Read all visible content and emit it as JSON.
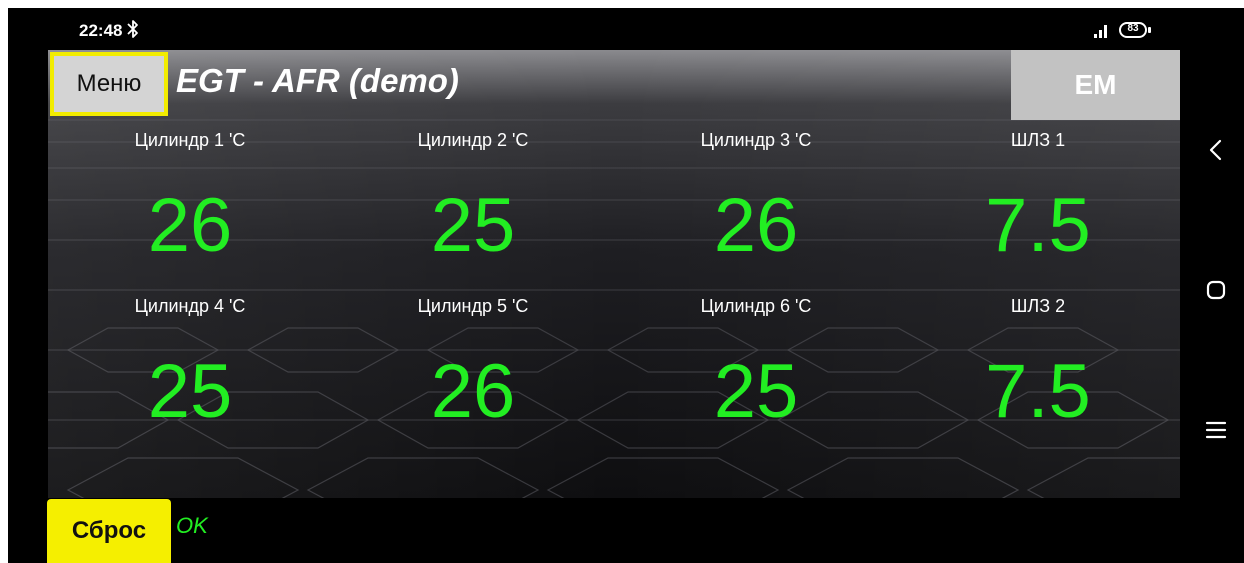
{
  "status_bar": {
    "time": "22:48",
    "battery": "83",
    "icons": [
      "bluetooth-icon",
      "signal-icon",
      "battery-icon"
    ]
  },
  "header": {
    "menu_label": "Меню",
    "title": "EGT - AFR (demo)",
    "em_label": "EM"
  },
  "sensors": [
    {
      "label": "Цилиндр 1 'C",
      "value": "26"
    },
    {
      "label": "Цилиндр 2 'C",
      "value": "25"
    },
    {
      "label": "Цилиндр 3 'C",
      "value": "26"
    },
    {
      "label": "ШЛЗ 1",
      "value": "7.5"
    },
    {
      "label": "Цилиндр 4 'C",
      "value": "25"
    },
    {
      "label": "Цилиндр 5 'C",
      "value": "26"
    },
    {
      "label": "Цилиндр 6 'C",
      "value": "25"
    },
    {
      "label": "ШЛЗ 2",
      "value": "7.5"
    }
  ],
  "footer": {
    "reset_label": "Сброс",
    "status": "OK"
  },
  "nav": {
    "icons": [
      "back-icon",
      "home-icon",
      "recents-icon"
    ]
  },
  "colors": {
    "value_green": "#22ee22",
    "menu_highlight": "#f2ec00",
    "reset_yellow": "#f5ef00",
    "em_gray": "#c2c2c2",
    "background": "#000000"
  }
}
